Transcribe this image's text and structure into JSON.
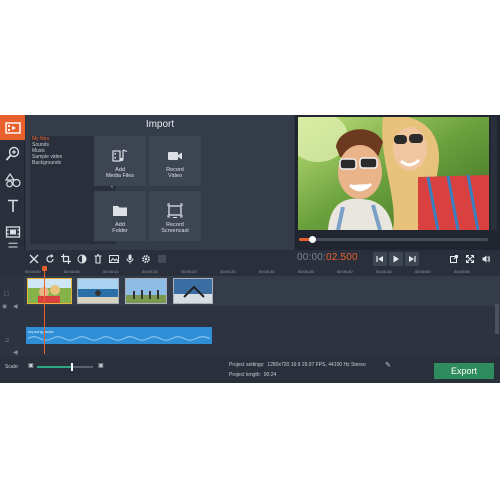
{
  "import": {
    "title": "Import",
    "library": [
      "My files",
      "Sounds",
      "Music",
      "Sample video",
      "Backgrounds"
    ],
    "collapse_icon": "chevron-left-icon",
    "buttons": [
      {
        "line1": "Add",
        "line2": "Media Files",
        "icon": "media-files-icon"
      },
      {
        "line1": "Record",
        "line2": "Video",
        "icon": "camera-icon"
      },
      {
        "line1": "Add",
        "line2": "Folder",
        "icon": "folder-icon"
      },
      {
        "line1": "Record",
        "line2": "Screencast",
        "icon": "screencast-icon"
      }
    ]
  },
  "sidebar_tools": [
    "import-icon",
    "filters-icon",
    "shapes-icon",
    "titles-icon",
    "transitions-icon",
    "more-icon"
  ],
  "edit_toolbar": [
    "cut-icon",
    "rotate-icon",
    "crop-icon",
    "color-icon",
    "delete-icon",
    "image-icon",
    "audio-icon",
    "settings-icon",
    "equalizer-icon"
  ],
  "player": {
    "time_prefix": "00:00:",
    "time_value": "02.500",
    "progress": 0.07,
    "controls": [
      "skip-back-icon",
      "play-icon",
      "skip-forward-icon"
    ],
    "extra": [
      "detach-icon",
      "fullscreen-icon",
      "volume-icon"
    ]
  },
  "ruler": [
    "00:00:00",
    "00:00:05",
    "00:00:10",
    "00:00:15",
    "00:00:20",
    "00:00:25",
    "00:00:30",
    "00:00:35",
    "00:00:40",
    "00:00:45",
    "00:00:50",
    "00:00:55"
  ],
  "timeline": {
    "audio_clip": "my.song.audio"
  },
  "bottom": {
    "scale_label": "Scale:",
    "scale_value": 0.6,
    "project_settings_label": "Project settings:",
    "project_settings_value": "1280x720 16:9 29.97 FPS, 44100 Hz Stereo",
    "project_length_label": "Project length:",
    "project_length_value": "00:24",
    "export_label": "Export"
  },
  "colors": {
    "accent": "#e8602c",
    "export": "#2e8c5e",
    "audio": "#2e8fd7",
    "background": "#2d3340"
  }
}
